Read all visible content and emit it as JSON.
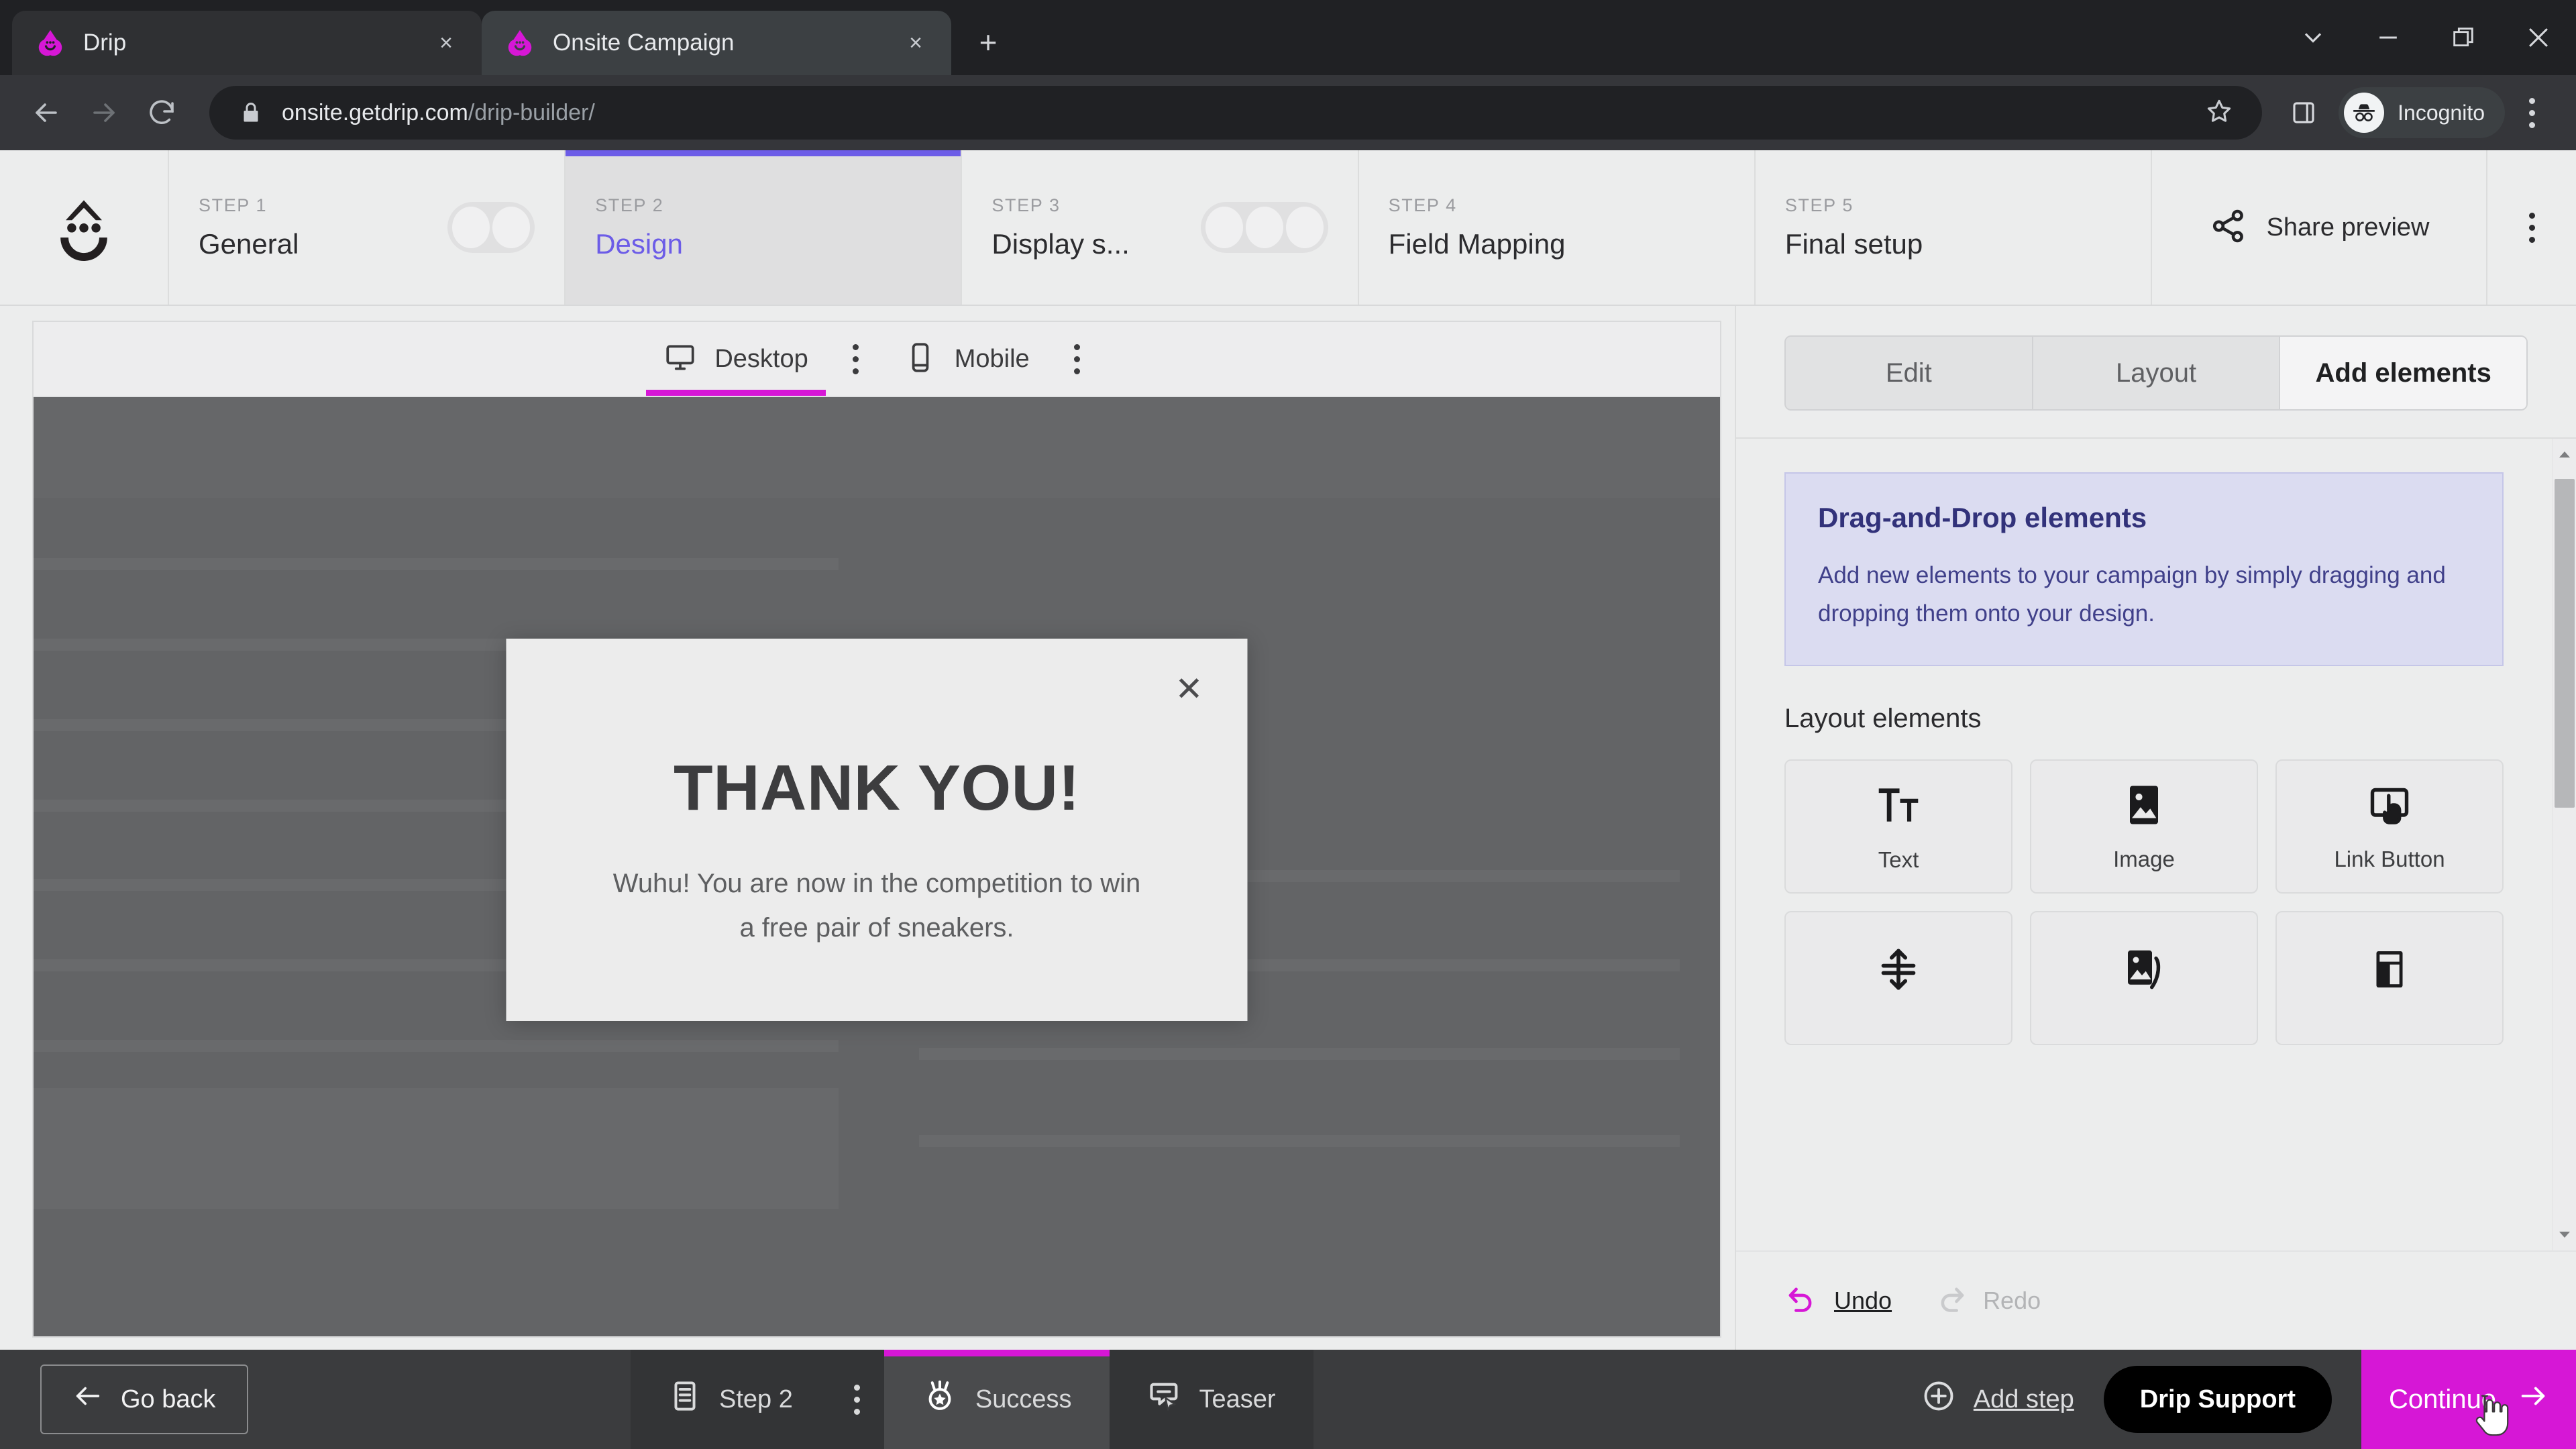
{
  "browser": {
    "tabs": [
      {
        "title": "Drip",
        "favicon": "drip-logo-icon",
        "active": false
      },
      {
        "title": "Onsite Campaign",
        "favicon": "drip-logo-icon",
        "active": true
      }
    ],
    "new_tab_label": "+",
    "close_label": "×",
    "window_controls": [
      "chevron-down-icon",
      "minimize-icon",
      "restore-icon",
      "close-icon"
    ],
    "url_host": "onsite.getdrip.com",
    "url_path": "/drip-builder/",
    "profile_label": "Incognito",
    "nav": {
      "back": "back-arrow",
      "forward": "forward-arrow",
      "reload": "reload-icon"
    }
  },
  "header": {
    "brand_icon": "drip-smiley-logo",
    "steps": [
      {
        "kicker": "STEP 1",
        "name": "General",
        "pills": 2,
        "active": false
      },
      {
        "kicker": "STEP 2",
        "name": "Design",
        "pills": 0,
        "active": true
      },
      {
        "kicker": "STEP 3",
        "name": "Display s...",
        "pills": 3,
        "active": false
      },
      {
        "kicker": "STEP 4",
        "name": "Field Mapping",
        "pills": 0,
        "active": false
      },
      {
        "kicker": "STEP 5",
        "name": "Final setup",
        "pills": 0,
        "active": false
      }
    ],
    "share_label": "Share preview",
    "share_icon": "share-nodes-icon",
    "kebab_icon": "more-vertical-icon"
  },
  "canvas": {
    "device_tabs": [
      {
        "label": "Desktop",
        "icon": "monitor-icon",
        "active": true
      },
      {
        "label": "Mobile",
        "icon": "phone-icon",
        "active": false
      }
    ],
    "kebab_icon": "more-vertical-icon",
    "preview": {
      "close_label": "✕",
      "title": "THANK YOU!",
      "subtitle_line1": "Wuhu! You are now in the competition to win",
      "subtitle_line2": "a free pair of sneakers."
    }
  },
  "panel": {
    "tabs": [
      {
        "label": "Edit",
        "active": false
      },
      {
        "label": "Layout",
        "active": false
      },
      {
        "label": "Add elements",
        "active": true
      }
    ],
    "info_card": {
      "title": "Drag-and-Drop elements",
      "body": "Add new elements to your campaign by simply dragging and dropping them onto your design."
    },
    "section_title": "Layout elements",
    "elements": [
      {
        "label": "Text",
        "icon": "text-size-icon"
      },
      {
        "label": "Image",
        "icon": "image-icon"
      },
      {
        "label": "Link Button",
        "icon": "link-button-tap-icon"
      },
      {
        "label": "",
        "icon": "spacer-vertical-arrows-icon"
      },
      {
        "label": "",
        "icon": "image-gallery-icon"
      },
      {
        "label": "",
        "icon": "columns-layout-icon"
      }
    ],
    "undo_label": "Undo",
    "redo_label": "Redo",
    "undo_icon": "undo-arrow-icon",
    "redo_icon": "redo-arrow-icon",
    "undo_color": "#d617d6"
  },
  "bottom": {
    "go_back_label": "Go back",
    "go_back_icon": "arrow-left-icon",
    "tabs": [
      {
        "label": "Step 2",
        "icon": "form-icon",
        "active": false
      },
      {
        "label": "Success",
        "icon": "award-icon",
        "active": true
      },
      {
        "label": "Teaser",
        "icon": "teaser-click-icon",
        "active": false
      }
    ],
    "kebab_icon": "more-vertical-icon",
    "add_step_label": "Add step",
    "add_step_icon": "plus-circle-icon",
    "support_label": "Drip Support",
    "continue_label": "Continue",
    "continue_icon": "arrow-right-icon",
    "continue_color": "#d617d6",
    "cursor": "pointer-hand-cursor"
  }
}
